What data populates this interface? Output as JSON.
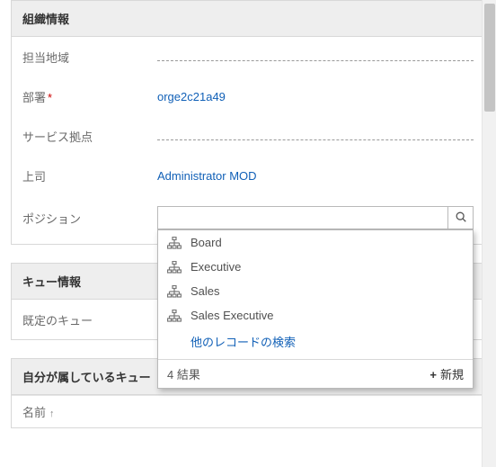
{
  "org_section": {
    "title": "組織情報",
    "rows": {
      "region": {
        "label": "担当地域"
      },
      "dept": {
        "label": "部署",
        "value": "orge2c21a49"
      },
      "site": {
        "label": "サービス拠点"
      },
      "manager": {
        "label": "上司",
        "value": "Administrator MOD"
      },
      "position": {
        "label": "ポジション",
        "input_value": ""
      }
    },
    "position_dropdown": {
      "items": [
        {
          "label": "Board"
        },
        {
          "label": "Executive"
        },
        {
          "label": "Sales"
        },
        {
          "label": "Sales Executive"
        }
      ],
      "search_more": "他のレコードの検索",
      "result_count_text": "4 結果",
      "new_label": "新規"
    }
  },
  "queue_section": {
    "title": "キュー情報",
    "default_queue_label": "既定のキュー"
  },
  "my_queues_section": {
    "title": "自分が属しているキュー",
    "name_col": "名前"
  }
}
